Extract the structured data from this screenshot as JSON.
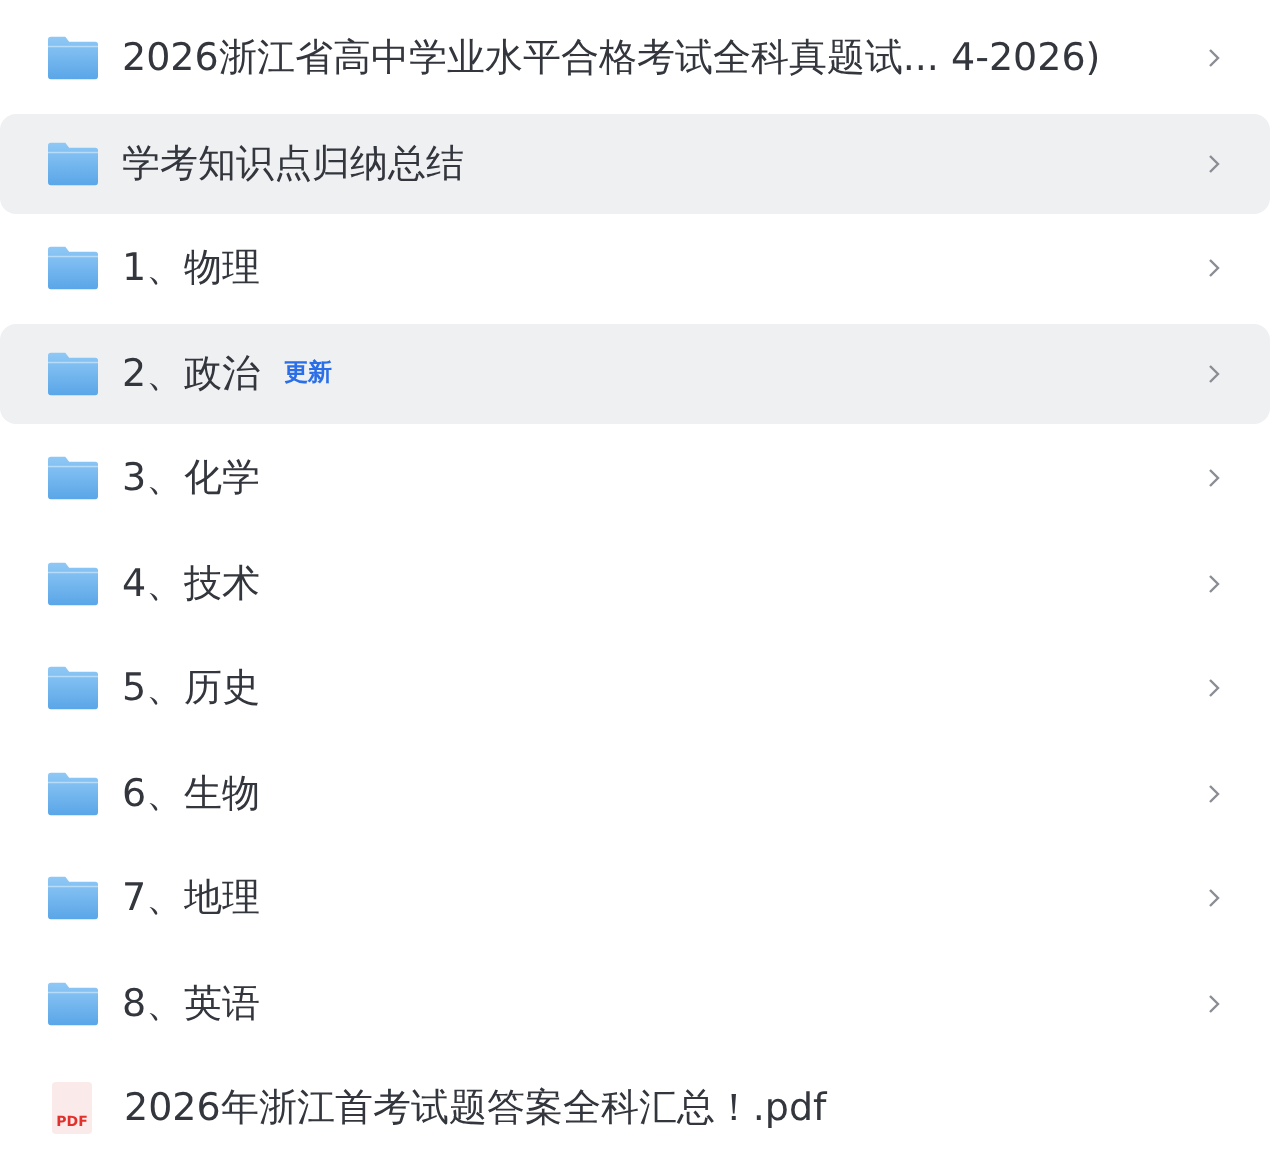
{
  "items": [
    {
      "kind": "folder",
      "name": "2026浙江省高中学业水平合格考试全科真题试... 4-2026)",
      "highlighted": false,
      "chevron": true
    },
    {
      "kind": "folder",
      "name": "学考知识点归纳总结",
      "highlighted": true,
      "chevron": true
    },
    {
      "kind": "folder",
      "name": "1、物理",
      "highlighted": false,
      "chevron": true
    },
    {
      "kind": "folder",
      "name": "2、政治",
      "badge": "更新",
      "highlighted": true,
      "chevron": true
    },
    {
      "kind": "folder",
      "name": "3、化学",
      "highlighted": false,
      "chevron": true
    },
    {
      "kind": "folder",
      "name": "4、技术",
      "highlighted": false,
      "chevron": true
    },
    {
      "kind": "folder",
      "name": "5、历史",
      "highlighted": false,
      "chevron": true
    },
    {
      "kind": "folder",
      "name": "6、生物",
      "highlighted": false,
      "chevron": true
    },
    {
      "kind": "folder",
      "name": "7、地理",
      "highlighted": false,
      "chevron": true
    },
    {
      "kind": "folder",
      "name": "8、英语",
      "highlighted": false,
      "chevron": true
    },
    {
      "kind": "pdf",
      "name": "2026年浙江首考试题答案全科汇总！.pdf",
      "icon_label": "PDF",
      "highlighted": false,
      "chevron": false
    }
  ]
}
